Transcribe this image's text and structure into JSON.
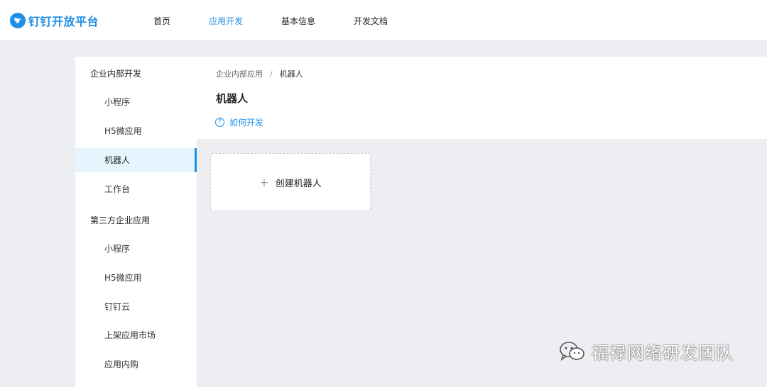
{
  "app": {
    "logo_text": "钉钉开放平台"
  },
  "topnav": {
    "items": [
      {
        "label": "首页"
      },
      {
        "label": "应用开发"
      },
      {
        "label": "基本信息"
      },
      {
        "label": "开发文档"
      }
    ],
    "active_index": 1
  },
  "sidebar": {
    "groups": [
      {
        "title": "企业内部开发",
        "items": [
          {
            "label": "小程序"
          },
          {
            "label": "H5微应用"
          },
          {
            "label": "机器人"
          },
          {
            "label": "工作台"
          }
        ]
      },
      {
        "title": "第三方企业应用",
        "items": [
          {
            "label": "小程序"
          },
          {
            "label": "H5微应用"
          },
          {
            "label": "钉钉云"
          },
          {
            "label": "上架应用市场"
          },
          {
            "label": "应用内购"
          }
        ]
      }
    ],
    "active": "机器人"
  },
  "main": {
    "breadcrumb": {
      "parent": "企业内部应用",
      "separator": "/",
      "current": "机器人"
    },
    "title": "机器人",
    "help_link": "如何开发",
    "create_card": {
      "label": "创建机器人"
    }
  },
  "watermark": {
    "text": "福禄网络研发团队"
  },
  "colors": {
    "accent": "#1e8fe8",
    "page_bg": "#eceef2",
    "active_item_bg": "#e6f4fd"
  }
}
